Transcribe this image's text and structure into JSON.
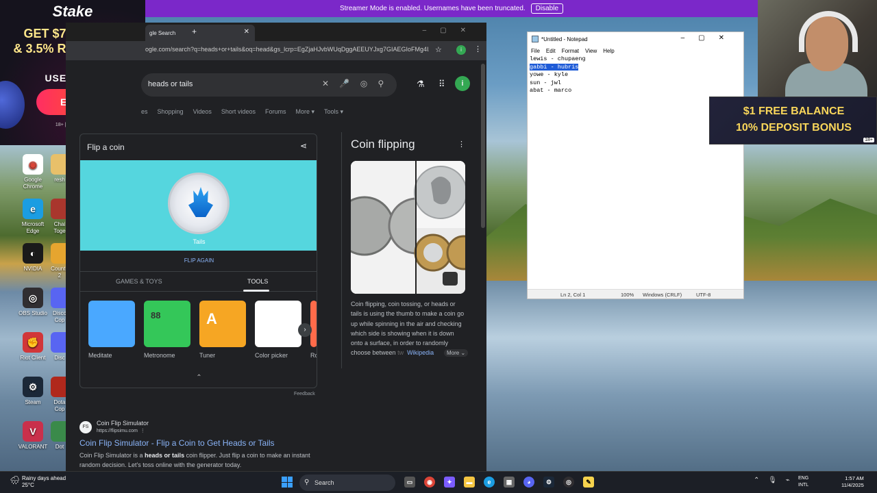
{
  "streamer_bar": {
    "message": "Streamer Mode is enabled. Usernames have been truncated.",
    "button": "Disable"
  },
  "stake_ad": {
    "logo": "Stake",
    "promo_line1": "GET $7 RELOAD",
    "promo_line2": "& 3.5% RAKEBACK!",
    "use_code": "USE CODE",
    "code": "ELYK",
    "terms": "18+ | T&C apply"
  },
  "bonus_ad": {
    "line1": "$1 FREE BALANCE",
    "line2": "10% DEPOSIT BONUS",
    "age": "18+"
  },
  "browser": {
    "tab_title": "gle Search",
    "url": "ogle.com/search?q=heads+or+tails&oq=head&gs_lcrp=EgZjaHJvbWUqDggAEEUYJxg7GIAEGIoFMg4IA...",
    "search_query": "heads or tails",
    "avatar_letter": "i",
    "nav_tabs": [
      "es",
      "Shopping",
      "Videos",
      "Short videos",
      "Forums",
      "More ▾",
      "Tools ▾"
    ],
    "coin_widget": {
      "title": "Flip a coin",
      "result": "Tails",
      "flip_again": "FLIP AGAIN",
      "tabs": [
        "GAMES & TOYS",
        "TOOLS"
      ],
      "tools": [
        {
          "label": "Meditate",
          "color": "#4aa8ff"
        },
        {
          "label": "Metronome",
          "color": "#34c759",
          "value": "88"
        },
        {
          "label": "Tuner",
          "color": "#f6a623",
          "value": "A"
        },
        {
          "label": "Color picker",
          "color": "#ffffff"
        },
        {
          "label": "Ro",
          "color": "#ff6b4a"
        }
      ],
      "feedback": "Feedback"
    },
    "knowledge_panel": {
      "title": "Coin flipping",
      "description": "Coin flipping, coin tossing, or heads or tails is using the thumb to make a coin go up while spinning in the air and checking which side is showing when it is down onto a surface, in order to randomly choose between ",
      "desc_faded": "tw",
      "wiki": "Wikipedia",
      "more": "More ⌄"
    },
    "result": {
      "favicon": "FS",
      "site": "Coin Flip Simulator",
      "url": "https://flipsimu.com",
      "title": "Coin Flip Simulator - Flip a Coin to Get Heads or Tails",
      "snippet_a": "Coin Flip Simulator is a ",
      "snippet_b": "heads or tails",
      "snippet_c": " coin flipper. Just flip a coin to make an instant random decision. Let's toss online with the generator today."
    }
  },
  "notepad": {
    "title": "*Untitled - Notepad",
    "menu": [
      "File",
      "Edit",
      "Format",
      "View",
      "Help"
    ],
    "lines": [
      "lewis - chupaeng",
      "gabbi - hubris",
      "yowe - kyle",
      "sun - jwl",
      "abat - marco"
    ],
    "status": {
      "position": "Ln 2, Col 1",
      "zoom": "100%",
      "eol": "Windows (CRLF)",
      "encoding": "UTF-8"
    }
  },
  "desktop_icons": [
    {
      "label": "Google Chrome",
      "color": "#ffffff",
      "glyph": "◉"
    },
    {
      "label": "Microsoft Edge",
      "color": "#1b9de2",
      "glyph": "e"
    },
    {
      "label": "NVIDIA",
      "color": "#1a1a1a",
      "glyph": "◐"
    },
    {
      "label": "OBS Studio",
      "color": "#302e31",
      "glyph": "◎"
    },
    {
      "label": "Riot Client",
      "color": "#d13639",
      "glyph": "✊"
    },
    {
      "label": "Steam",
      "color": "#1b2838",
      "glyph": "⚙"
    },
    {
      "label": "VALORANT",
      "color": "#c9304b",
      "glyph": "V"
    }
  ],
  "desktop_icons_col2": [
    {
      "label": "resh",
      "color": "#e8c06a"
    },
    {
      "label": "Chai Toge",
      "color": "#a9362d"
    },
    {
      "label": "Counte 2",
      "color": "#e6a52f"
    },
    {
      "label": "Disco Cop",
      "color": "#5865f2"
    },
    {
      "label": "Disc",
      "color": "#5865f2"
    },
    {
      "label": "Dota Cop",
      "color": "#b0281c"
    },
    {
      "label": "Dot",
      "color": "#3a8a4a"
    }
  ],
  "taskbar": {
    "weather_line1": "Rainy days ahead",
    "weather_line2": "25°C",
    "search": "Search",
    "lang_line1": "ENG",
    "lang_line2": "INTL",
    "time": "1:57 AM",
    "date": "11/4/2025"
  }
}
